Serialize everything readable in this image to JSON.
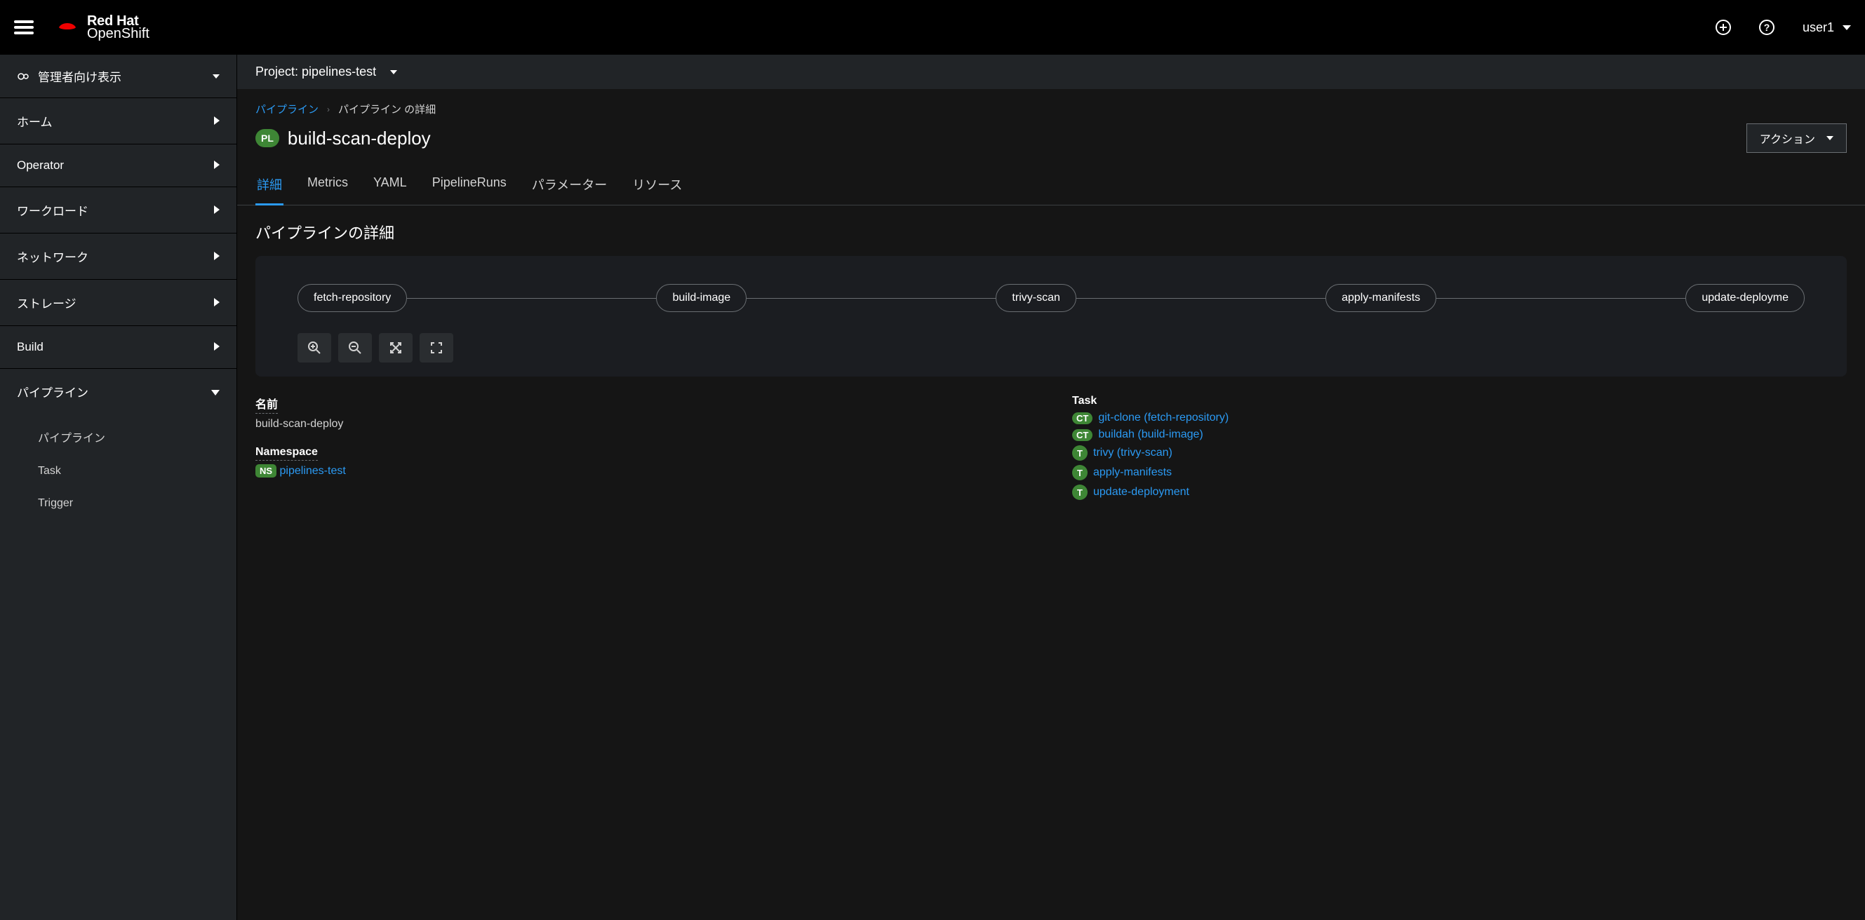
{
  "masthead": {
    "brand1": "Red Hat",
    "brand2": "OpenShift",
    "user": "user1"
  },
  "sidebar": {
    "perspective": "管理者向け表示",
    "items": [
      {
        "label": "ホーム",
        "expandable": true,
        "expanded": false
      },
      {
        "label": "Operator",
        "expandable": true,
        "expanded": false
      },
      {
        "label": "ワークロード",
        "expandable": true,
        "expanded": false
      },
      {
        "label": "ネットワーク",
        "expandable": true,
        "expanded": false
      },
      {
        "label": "ストレージ",
        "expandable": true,
        "expanded": false
      },
      {
        "label": "Build",
        "expandable": true,
        "expanded": false
      },
      {
        "label": "パイプライン",
        "expandable": true,
        "expanded": true,
        "children": [
          {
            "label": "パイプライン"
          },
          {
            "label": "Task"
          },
          {
            "label": "Trigger"
          }
        ]
      }
    ]
  },
  "project": {
    "label": "Project:",
    "name": "pipelines-test"
  },
  "breadcrumb": {
    "root": "パイプライン",
    "current": "パイプライン の詳細"
  },
  "page": {
    "badge": "PL",
    "title": "build-scan-deploy",
    "actions": "アクション"
  },
  "tabs": [
    {
      "label": "詳細",
      "active": true
    },
    {
      "label": "Metrics",
      "active": false
    },
    {
      "label": "YAML",
      "active": false
    },
    {
      "label": "PipelineRuns",
      "active": false
    },
    {
      "label": "パラメーター",
      "active": false
    },
    {
      "label": "リソース",
      "active": false
    }
  ],
  "section_title": "パイプラインの詳細",
  "pipeline_tasks": [
    "fetch-repository",
    "build-image",
    "trivy-scan",
    "apply-manifests",
    "update-deployme"
  ],
  "details": {
    "name_label": "名前",
    "name_value": "build-scan-deploy",
    "namespace_label": "Namespace",
    "namespace_badge": "NS",
    "namespace_value": "pipelines-test",
    "tasks_label": "Task",
    "tasks": [
      {
        "badge": "CT",
        "text": "git-clone (fetch-repository)"
      },
      {
        "badge": "CT",
        "text": "buildah (build-image)"
      },
      {
        "badge": "T",
        "text": "trivy (trivy-scan)"
      },
      {
        "badge": "T",
        "text": "apply-manifests"
      },
      {
        "badge": "T",
        "text": "update-deployment"
      }
    ]
  }
}
